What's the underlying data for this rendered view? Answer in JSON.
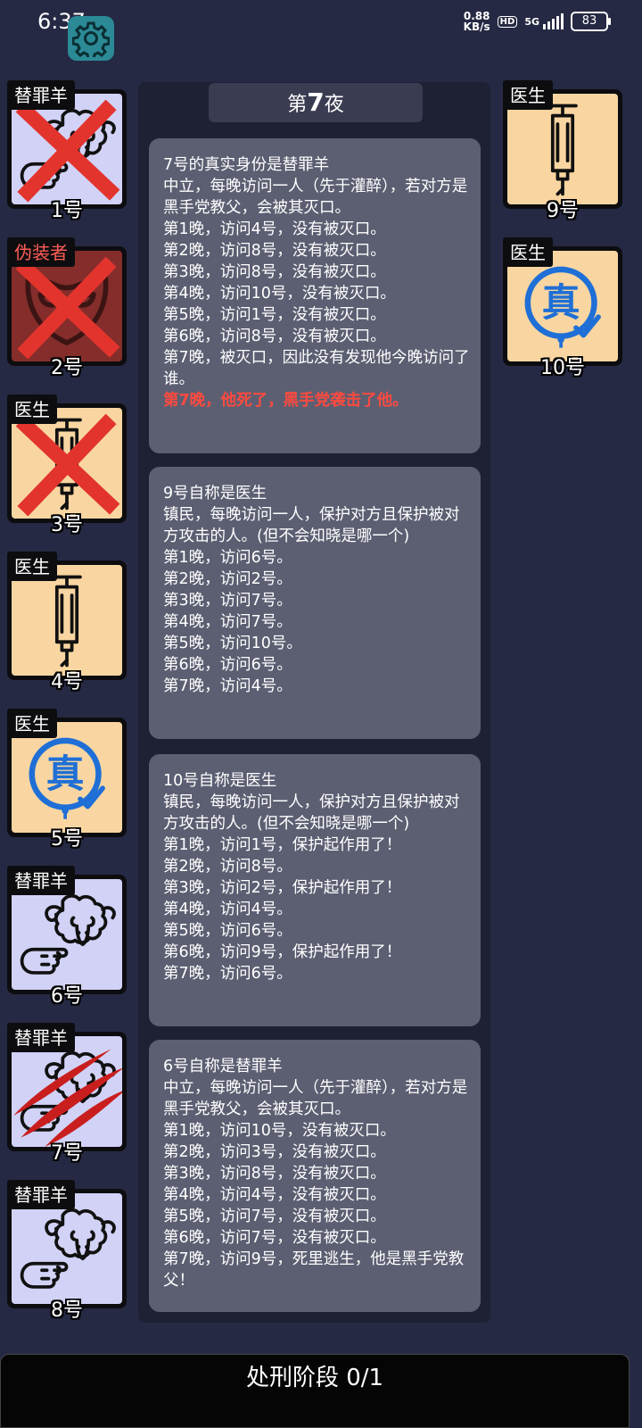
{
  "status_bar": {
    "time": "6:37",
    "net_speed": "0.88",
    "net_unit": "KB/s",
    "hd": "HD",
    "signal": "5G",
    "battery": "83"
  },
  "header": {
    "night_prefix": "第",
    "night_number": "7",
    "night_suffix": "夜"
  },
  "players": [
    {
      "number": "1号",
      "role": "替罪羊",
      "status": "dead"
    },
    {
      "number": "2号",
      "role": "伪装者",
      "status": "dead"
    },
    {
      "number": "3号",
      "role": "医生",
      "status": "dead"
    },
    {
      "number": "4号",
      "role": "医生",
      "status": "alive"
    },
    {
      "number": "5号",
      "role": "医生",
      "status": "verified",
      "badge": "真"
    },
    {
      "number": "6号",
      "role": "替罪羊",
      "status": "alive"
    },
    {
      "number": "7号",
      "role": "替罪羊",
      "status": "attacked"
    },
    {
      "number": "8号",
      "role": "替罪羊",
      "status": "alive"
    },
    {
      "number": "9号",
      "role": "医生",
      "status": "alive"
    },
    {
      "number": "10号",
      "role": "医生",
      "status": "verified",
      "badge": "真"
    }
  ],
  "messages": [
    {
      "lines": [
        "7号的真实身份是替罪羊",
        "中立，每晚访问一人（先于灌醉），若对方是黑手党教父，会被其灭口。",
        "第1晚，访问4号，没有被灭口。",
        "第2晚，访问8号，没有被灭口。",
        "第3晚，访问8号，没有被灭口。",
        "第4晚，访问10号，没有被灭口。",
        "第5晚，访问1号，没有被灭口。",
        "第6晚，访问8号，没有被灭口。",
        "第7晚，被灭口，因此没有发现他今晚访问了谁。"
      ],
      "highlight": "第7晚，他死了，黑手党袭击了他。"
    },
    {
      "lines": [
        "9号自称是医生",
        "镇民，每晚访问一人，保护对方且保护被对方攻击的人。(但不会知晓是哪一个)",
        "第1晚，访问6号。",
        "第2晚，访问2号。",
        "第3晚，访问7号。",
        "第4晚，访问7号。",
        "第5晚，访问10号。",
        "第6晚，访问6号。",
        "第7晚，访问4号。"
      ]
    },
    {
      "lines": [
        "10号自称是医生",
        "镇民，每晚访问一人，保护对方且保护被对方攻击的人。(但不会知晓是哪一个)",
        "第1晚，访问1号，保护起作用了！",
        "第2晚，访问8号。",
        "第3晚，访问2号，保护起作用了！",
        "第4晚，访问4号。",
        "第5晚，访问6号。",
        "第6晚，访问9号，保护起作用了！",
        "第7晚，访问6号。"
      ]
    },
    {
      "lines": [
        "6号自称是替罪羊",
        "中立，每晚访问一人（先于灌醉），若对方是黑手党教父，会被其灭口。",
        "第1晚，访问10号，没有被灭口。",
        "第2晚，访问3号，没有被灭口。",
        "第3晚，访问8号，没有被灭口。",
        "第4晚，访问4号，没有被灭口。",
        "第5晚，访问7号，没有被灭口。",
        "第6晚，访问7号，没有被灭口。",
        "第7晚，访问9号，死里逃生，他是黑手党教父！"
      ]
    }
  ],
  "bottom": {
    "label": "处刑阶段 0/1"
  },
  "colors": {
    "background": "#262943",
    "panel": "#1e2034",
    "message_bg": "#5c5f72",
    "highlight": "#ff4a3f",
    "scapegoat_bg": "#d1d2f6",
    "doctor_bg": "#f9d6a1",
    "disguiser_bg": "#842d2b",
    "settings_button": "#2b8a96"
  },
  "icons": {
    "settings": "gear-icon",
    "scapegoat": "sheep-pointing-icon",
    "doctor": "syringe-icon",
    "disguiser": "mask-icon",
    "dead": "red-x-icon",
    "attacked": "claw-scratch-icon",
    "verified": "true-stamp-icon"
  }
}
